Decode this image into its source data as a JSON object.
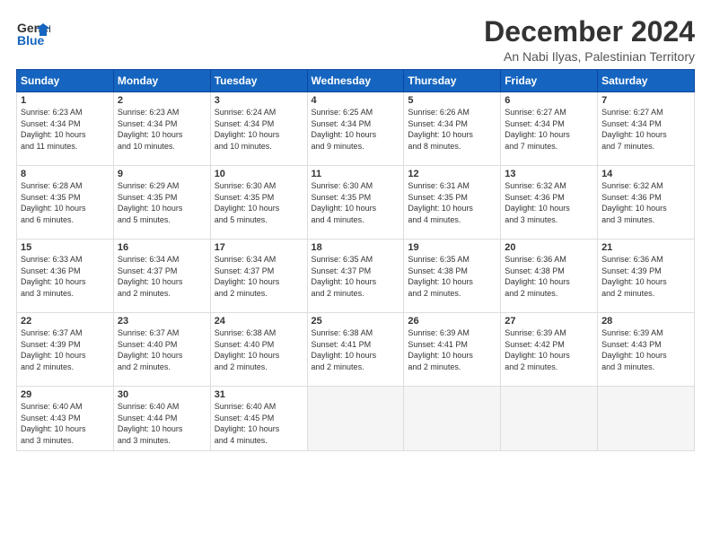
{
  "header": {
    "logo_line1": "General",
    "logo_line2": "Blue",
    "month": "December 2024",
    "location": "An Nabi Ilyas, Palestinian Territory"
  },
  "days_of_week": [
    "Sunday",
    "Monday",
    "Tuesday",
    "Wednesday",
    "Thursday",
    "Friday",
    "Saturday"
  ],
  "weeks": [
    [
      {
        "num": "1",
        "info": "Sunrise: 6:23 AM\nSunset: 4:34 PM\nDaylight: 10 hours\nand 11 minutes."
      },
      {
        "num": "2",
        "info": "Sunrise: 6:23 AM\nSunset: 4:34 PM\nDaylight: 10 hours\nand 10 minutes."
      },
      {
        "num": "3",
        "info": "Sunrise: 6:24 AM\nSunset: 4:34 PM\nDaylight: 10 hours\nand 10 minutes."
      },
      {
        "num": "4",
        "info": "Sunrise: 6:25 AM\nSunset: 4:34 PM\nDaylight: 10 hours\nand 9 minutes."
      },
      {
        "num": "5",
        "info": "Sunrise: 6:26 AM\nSunset: 4:34 PM\nDaylight: 10 hours\nand 8 minutes."
      },
      {
        "num": "6",
        "info": "Sunrise: 6:27 AM\nSunset: 4:34 PM\nDaylight: 10 hours\nand 7 minutes."
      },
      {
        "num": "7",
        "info": "Sunrise: 6:27 AM\nSunset: 4:34 PM\nDaylight: 10 hours\nand 7 minutes."
      }
    ],
    [
      {
        "num": "8",
        "info": "Sunrise: 6:28 AM\nSunset: 4:35 PM\nDaylight: 10 hours\nand 6 minutes."
      },
      {
        "num": "9",
        "info": "Sunrise: 6:29 AM\nSunset: 4:35 PM\nDaylight: 10 hours\nand 5 minutes."
      },
      {
        "num": "10",
        "info": "Sunrise: 6:30 AM\nSunset: 4:35 PM\nDaylight: 10 hours\nand 5 minutes."
      },
      {
        "num": "11",
        "info": "Sunrise: 6:30 AM\nSunset: 4:35 PM\nDaylight: 10 hours\nand 4 minutes."
      },
      {
        "num": "12",
        "info": "Sunrise: 6:31 AM\nSunset: 4:35 PM\nDaylight: 10 hours\nand 4 minutes."
      },
      {
        "num": "13",
        "info": "Sunrise: 6:32 AM\nSunset: 4:36 PM\nDaylight: 10 hours\nand 3 minutes."
      },
      {
        "num": "14",
        "info": "Sunrise: 6:32 AM\nSunset: 4:36 PM\nDaylight: 10 hours\nand 3 minutes."
      }
    ],
    [
      {
        "num": "15",
        "info": "Sunrise: 6:33 AM\nSunset: 4:36 PM\nDaylight: 10 hours\nand 3 minutes."
      },
      {
        "num": "16",
        "info": "Sunrise: 6:34 AM\nSunset: 4:37 PM\nDaylight: 10 hours\nand 2 minutes."
      },
      {
        "num": "17",
        "info": "Sunrise: 6:34 AM\nSunset: 4:37 PM\nDaylight: 10 hours\nand 2 minutes."
      },
      {
        "num": "18",
        "info": "Sunrise: 6:35 AM\nSunset: 4:37 PM\nDaylight: 10 hours\nand 2 minutes."
      },
      {
        "num": "19",
        "info": "Sunrise: 6:35 AM\nSunset: 4:38 PM\nDaylight: 10 hours\nand 2 minutes."
      },
      {
        "num": "20",
        "info": "Sunrise: 6:36 AM\nSunset: 4:38 PM\nDaylight: 10 hours\nand 2 minutes."
      },
      {
        "num": "21",
        "info": "Sunrise: 6:36 AM\nSunset: 4:39 PM\nDaylight: 10 hours\nand 2 minutes."
      }
    ],
    [
      {
        "num": "22",
        "info": "Sunrise: 6:37 AM\nSunset: 4:39 PM\nDaylight: 10 hours\nand 2 minutes."
      },
      {
        "num": "23",
        "info": "Sunrise: 6:37 AM\nSunset: 4:40 PM\nDaylight: 10 hours\nand 2 minutes."
      },
      {
        "num": "24",
        "info": "Sunrise: 6:38 AM\nSunset: 4:40 PM\nDaylight: 10 hours\nand 2 minutes."
      },
      {
        "num": "25",
        "info": "Sunrise: 6:38 AM\nSunset: 4:41 PM\nDaylight: 10 hours\nand 2 minutes."
      },
      {
        "num": "26",
        "info": "Sunrise: 6:39 AM\nSunset: 4:41 PM\nDaylight: 10 hours\nand 2 minutes."
      },
      {
        "num": "27",
        "info": "Sunrise: 6:39 AM\nSunset: 4:42 PM\nDaylight: 10 hours\nand 2 minutes."
      },
      {
        "num": "28",
        "info": "Sunrise: 6:39 AM\nSunset: 4:43 PM\nDaylight: 10 hours\nand 3 minutes."
      }
    ],
    [
      {
        "num": "29",
        "info": "Sunrise: 6:40 AM\nSunset: 4:43 PM\nDaylight: 10 hours\nand 3 minutes."
      },
      {
        "num": "30",
        "info": "Sunrise: 6:40 AM\nSunset: 4:44 PM\nDaylight: 10 hours\nand 3 minutes."
      },
      {
        "num": "31",
        "info": "Sunrise: 6:40 AM\nSunset: 4:45 PM\nDaylight: 10 hours\nand 4 minutes."
      },
      {
        "num": "",
        "info": ""
      },
      {
        "num": "",
        "info": ""
      },
      {
        "num": "",
        "info": ""
      },
      {
        "num": "",
        "info": ""
      }
    ]
  ]
}
